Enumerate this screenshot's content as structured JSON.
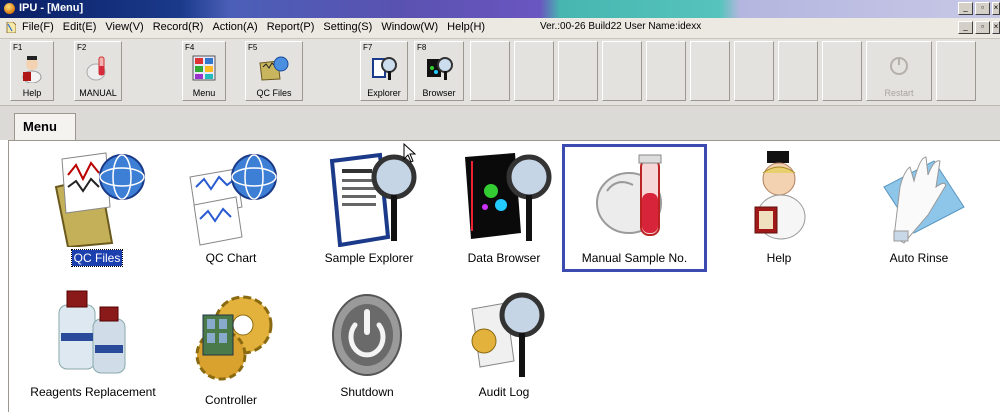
{
  "window": {
    "title": "IPU - [Menu]"
  },
  "menubar": {
    "items": [
      "File(F)",
      "Edit(E)",
      "View(V)",
      "Record(R)",
      "Action(A)",
      "Report(P)",
      "Setting(S)",
      "Window(W)",
      "Help(H)"
    ],
    "version": "Ver.:00-26 Build22 User Name:idexx"
  },
  "toolbar": {
    "buttons": [
      {
        "key": "F1",
        "label": "Help",
        "icon": "help-doctor-icon"
      },
      {
        "key": "F2",
        "label": "MANUAL",
        "icon": "manual-tube-icon"
      },
      {
        "key": "F4",
        "label": "Menu",
        "icon": "menu-grid-icon"
      },
      {
        "key": "F5",
        "label": "QC Files",
        "icon": "qc-files-icon"
      },
      {
        "key": "F7",
        "label": "Explorer",
        "icon": "explorer-icon"
      },
      {
        "key": "F8",
        "label": "Browser",
        "icon": "browser-icon"
      },
      {
        "key": "",
        "label": "Restart",
        "icon": "restart-icon"
      }
    ]
  },
  "tab": {
    "label": "Menu"
  },
  "menu_items": [
    {
      "label": "QC Files",
      "icon": "qc-files-icon"
    },
    {
      "label": "QC Chart",
      "icon": "qc-chart-icon"
    },
    {
      "label": "Sample Explorer",
      "icon": "sample-explorer-icon"
    },
    {
      "label": "Data Browser",
      "icon": "data-browser-icon"
    },
    {
      "label": "Manual Sample No.",
      "icon": "manual-sample-icon"
    },
    {
      "label": "Help",
      "icon": "help-doctor-icon"
    },
    {
      "label": "Auto Rinse",
      "icon": "auto-rinse-icon"
    },
    {
      "label": "Reagents Replacement",
      "icon": "reagents-icon"
    },
    {
      "label": "Controller",
      "icon": "controller-gear-icon"
    },
    {
      "label": "Shutdown",
      "icon": "shutdown-icon"
    },
    {
      "label": "Audit Log",
      "icon": "audit-log-icon"
    }
  ],
  "colors": {
    "title_start": "#0a1f66",
    "selection": "#1c3fb0",
    "focus_border": "#3b4bb0"
  }
}
